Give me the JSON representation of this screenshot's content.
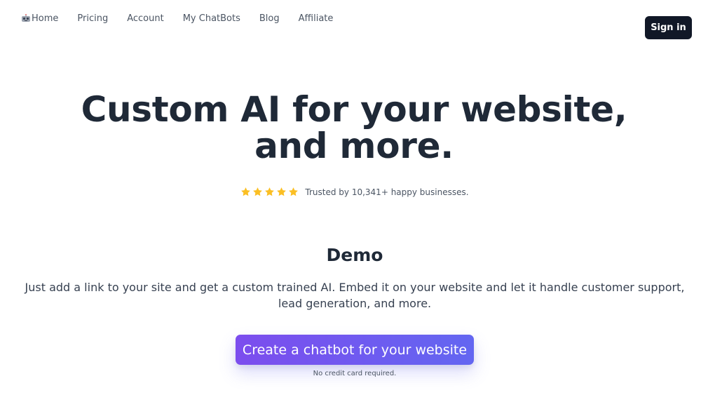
{
  "nav": {
    "items": [
      {
        "label": "Home",
        "icon": "robot-icon"
      },
      {
        "label": "Pricing"
      },
      {
        "label": "Account"
      },
      {
        "label": "My ChatBots"
      },
      {
        "label": "Blog"
      },
      {
        "label": "Affiliate"
      }
    ],
    "signin_label": "Sign in"
  },
  "hero": {
    "title": "Custom AI for your website, and more.",
    "rating": {
      "stars": 5,
      "star_color": "#fbbf24",
      "text": "Trusted by 10,341+ happy businesses."
    }
  },
  "demo": {
    "heading": "Demo",
    "description": "Just add a link to your site and get a custom trained AI. Embed it on your website and let it handle customer support, lead generation, and more.",
    "cta_label": "Create a chatbot for your website",
    "note": "No credit card required."
  },
  "colors": {
    "signin_bg": "#111827",
    "cta_gradient_start": "#7c4dee",
    "cta_gradient_end": "#6366f1",
    "heading_text": "#1f2937"
  }
}
